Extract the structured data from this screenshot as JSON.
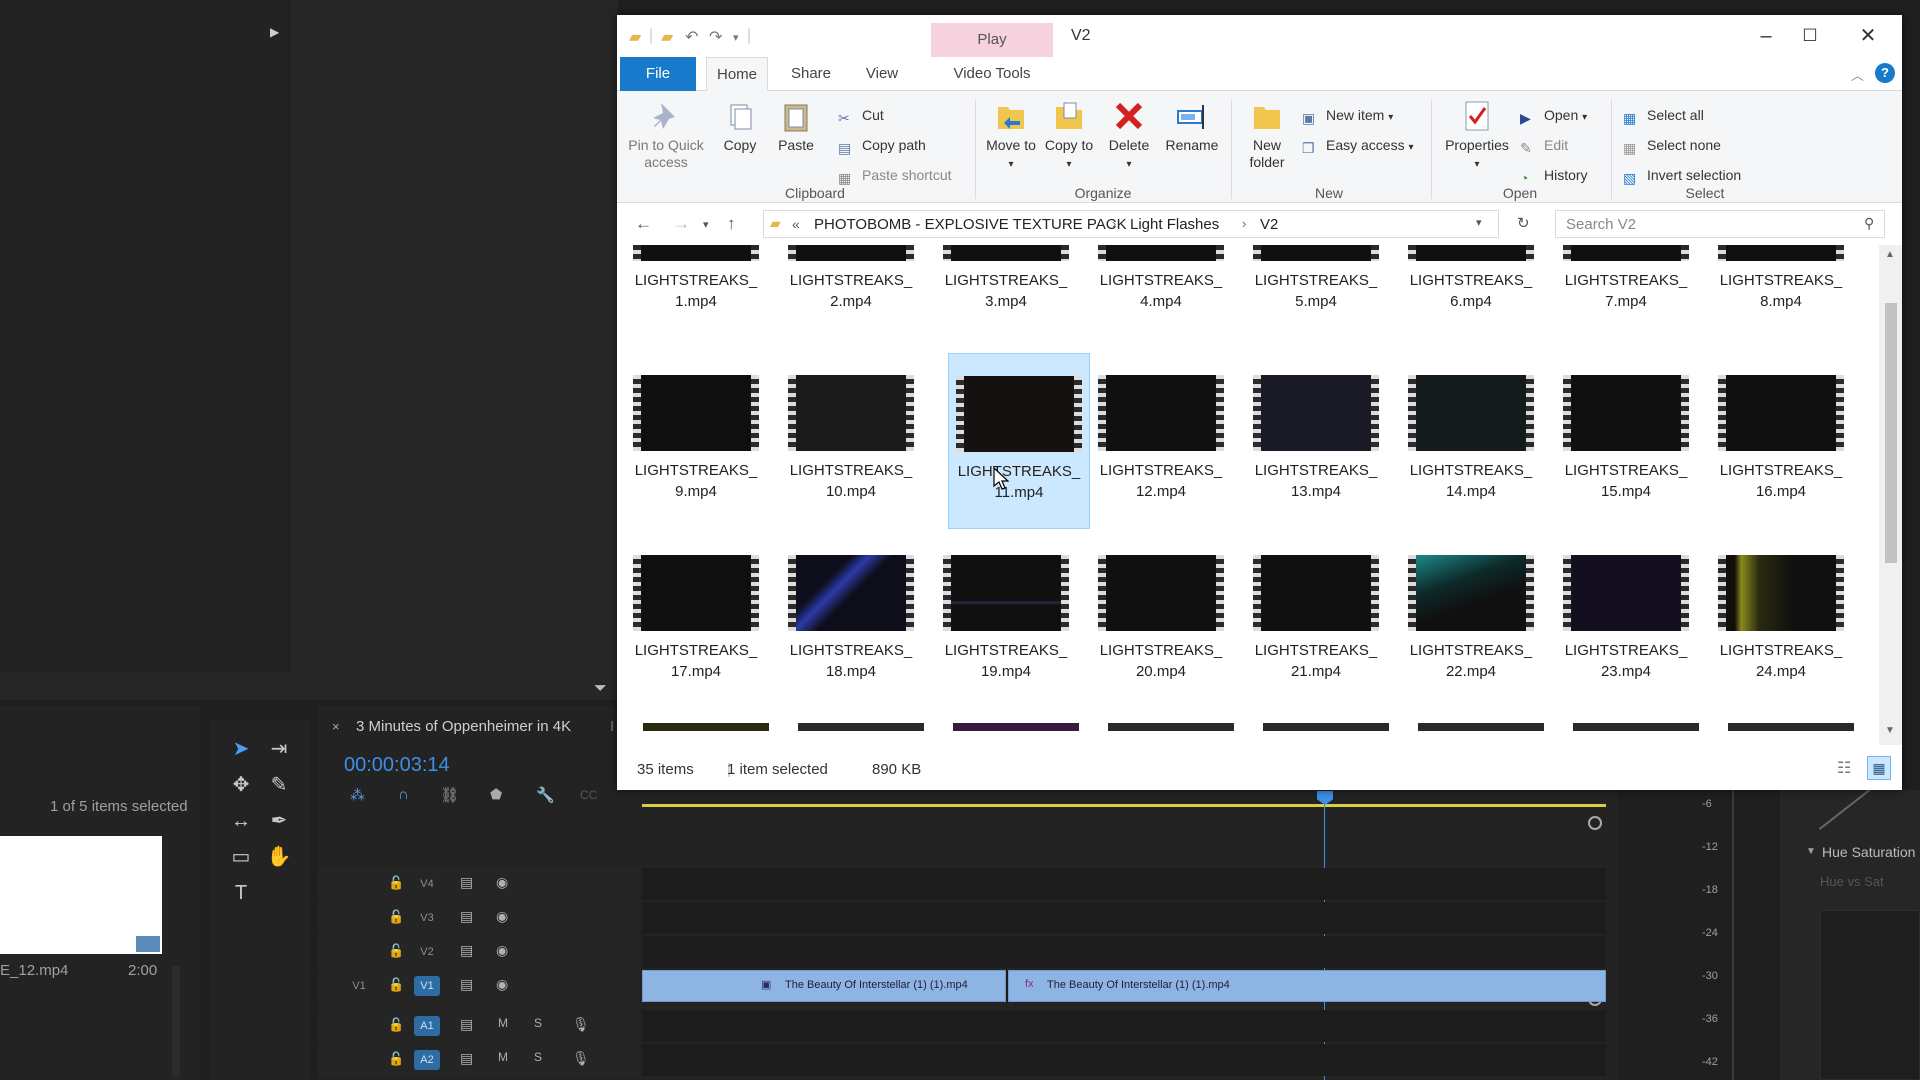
{
  "premiere": {
    "selection_count": "1 of 5 items selected",
    "clip_name": "E_12.mp4",
    "clip_duration": "2:00",
    "sequence_tab": "3 Minutes of Oppenheimer in 4K",
    "sequence_tab_extra": "I",
    "timecode": "00:00:03:14",
    "tracks": [
      {
        "name": "V4"
      },
      {
        "name": "V3"
      },
      {
        "name": "V2"
      },
      {
        "name": "V1",
        "source": "V1"
      },
      {
        "name": "A1",
        "m": "M",
        "s": "S"
      },
      {
        "name": "A2",
        "m": "M",
        "s": "S"
      }
    ],
    "clips": [
      "The Beauty Of Interstellar (1) (1).mp4",
      "The Beauty Of Interstellar (1) (1).mp4"
    ],
    "meter_ticks": [
      "-6",
      "-12",
      "-18",
      "-24",
      "-30",
      "-36",
      "-42"
    ],
    "effect_panel_title": "Hue Saturation",
    "effect_panel_sub": "Hue vs Sat"
  },
  "explorer": {
    "window_title": "V2",
    "contextual_tab": "Play",
    "tabs": [
      "File",
      "Home",
      "Share",
      "View",
      "Video Tools"
    ],
    "clipboard": {
      "pin": "Pin to Quick access",
      "copy": "Copy",
      "paste": "Paste",
      "cut": "Cut",
      "copy_path": "Copy path",
      "paste_shortcut": "Paste shortcut",
      "group": "Clipboard"
    },
    "organize": {
      "move_to": "Move to",
      "copy_to": "Copy to",
      "delete": "Delete",
      "rename": "Rename",
      "group": "Organize"
    },
    "new": {
      "new_folder": "New folder",
      "new_item": "New item",
      "easy_access": "Easy access",
      "group": "New"
    },
    "open": {
      "properties": "Properties",
      "open": "Open",
      "edit": "Edit",
      "history": "History",
      "group": "Open"
    },
    "select": {
      "select_all": "Select all",
      "select_none": "Select none",
      "invert": "Invert selection",
      "group": "Select"
    },
    "breadcrumb": [
      "«",
      "PHOTOBOMB - EXPLOSIVE TEXTURE PACK",
      "Light Flashes",
      "V2"
    ],
    "search_placeholder": "Search V2",
    "files": [
      "LIGHTSTREAKS_1.mp4",
      "LIGHTSTREAKS_2.mp4",
      "LIGHTSTREAKS_3.mp4",
      "LIGHTSTREAKS_4.mp4",
      "LIGHTSTREAKS_5.mp4",
      "LIGHTSTREAKS_6.mp4",
      "LIGHTSTREAKS_7.mp4",
      "LIGHTSTREAKS_8.mp4",
      "LIGHTSTREAKS_9.mp4",
      "LIGHTSTREAKS_10.mp4",
      "LIGHTSTREAKS_11.mp4",
      "LIGHTSTREAKS_12.mp4",
      "LIGHTSTREAKS_13.mp4",
      "LIGHTSTREAKS_14.mp4",
      "LIGHTSTREAKS_15.mp4",
      "LIGHTSTREAKS_16.mp4",
      "LIGHTSTREAKS_17.mp4",
      "LIGHTSTREAKS_18.mp4",
      "LIGHTSTREAKS_19.mp4",
      "LIGHTSTREAKS_20.mp4",
      "LIGHTSTREAKS_21.mp4",
      "LIGHTSTREAKS_22.mp4",
      "LIGHTSTREAKS_23.mp4",
      "LIGHTSTREAKS_24.mp4"
    ],
    "selected_file": "LIGHTSTREAKS_11.mp4",
    "status_count": "35 items",
    "status_selected": "1 item selected",
    "status_size": "890 KB"
  },
  "colors": {
    "accent": "#1979ca",
    "play_tab": "#f6d2de",
    "selection": "#cce8ff",
    "premiere_blue": "#2d8ceb",
    "clip": "#8eb4e3"
  }
}
